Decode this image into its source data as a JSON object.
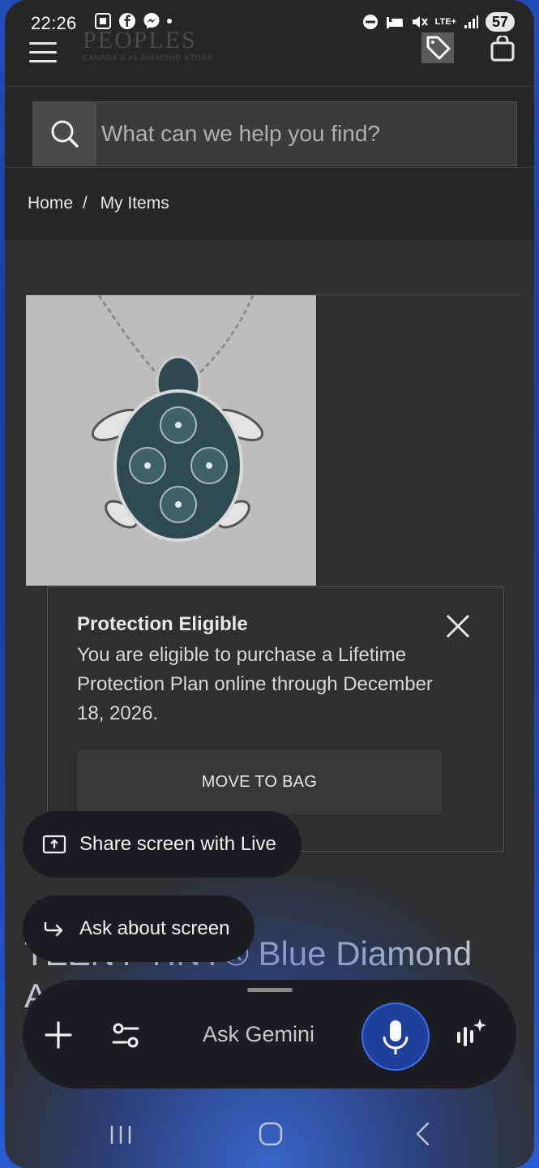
{
  "status": {
    "time": "22:26",
    "battery": "57",
    "network": "LTE+"
  },
  "header": {
    "logo_text": "PEOPLES",
    "logo_tagline": "CANADA'S #1 DIAMOND STORE"
  },
  "search": {
    "placeholder": "What can we help you find?"
  },
  "breadcrumb": {
    "home": "Home",
    "separator": "/",
    "current": "My Items"
  },
  "protection": {
    "title": "Protection Eligible",
    "message": "You are eligible to purchase a Lifetime Protection Plan online through December 18, 2026.",
    "button_label": "MOVE TO BAG"
  },
  "product": {
    "title_visible": "TEENY TINY® Blue Diamond",
    "title_second_line_start": "A"
  },
  "gemini": {
    "share_label": "Share screen with Live",
    "ask_label": "Ask about screen",
    "prompt_placeholder": "Ask Gemini",
    "accent_color": "#3e6ef0"
  },
  "colors": {
    "page_bg": "#2f2f2f",
    "header_bg": "#262626",
    "product_image_bg": "#bdbdbd"
  }
}
